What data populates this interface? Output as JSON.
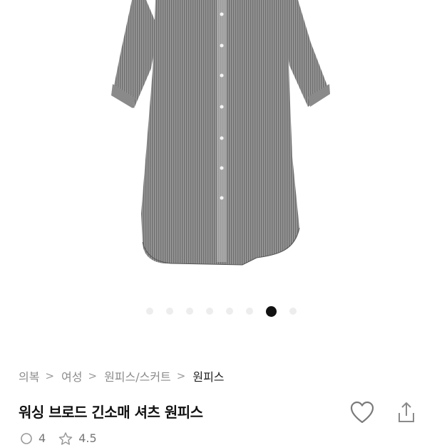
{
  "carousel": {
    "total": 8,
    "active_index": 6
  },
  "breadcrumb": {
    "items": [
      "의복",
      "여성",
      "원피스/스커트",
      "원피스"
    ],
    "separator": ">"
  },
  "product": {
    "title": "워싱 브로드 긴소매 셔츠 원피스",
    "comment_count": "4",
    "rating": "4.5"
  },
  "colors": {
    "active_dot": "#111111",
    "inactive_dot": "#ededed",
    "muted_text": "#8c8c8c"
  },
  "icons": {
    "like": "heart-icon",
    "share": "share-icon",
    "comments": "comment-icon",
    "rating": "star-icon"
  }
}
